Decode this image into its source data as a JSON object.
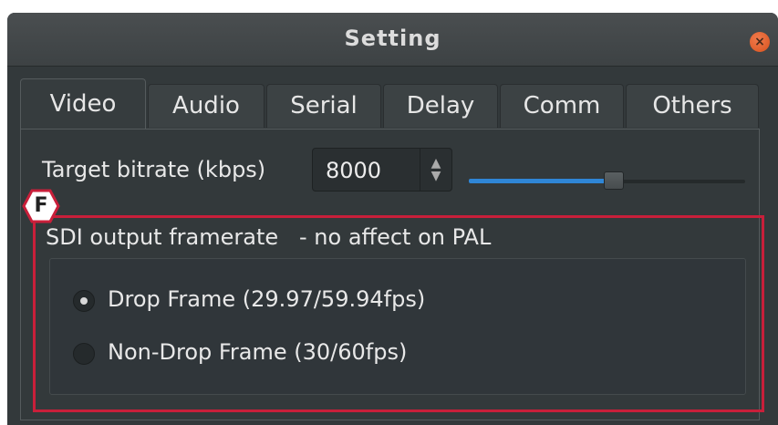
{
  "window": {
    "title": "Setting",
    "close_icon": "close-icon",
    "close_glyph": "×"
  },
  "tabs": [
    {
      "label": "Video",
      "active": true
    },
    {
      "label": "Audio",
      "active": false
    },
    {
      "label": "Serial",
      "active": false
    },
    {
      "label": "Delay",
      "active": false
    },
    {
      "label": "Comm",
      "active": false
    },
    {
      "label": "Others",
      "active": false
    }
  ],
  "video": {
    "bitrate_label": "Target bitrate (kbps)",
    "bitrate_value": "8000",
    "slider_level": 0.5,
    "framerate_group_label": "SDI output framerate   - no affect on PAL",
    "options": [
      {
        "label": "Drop Frame (29.97/59.94fps)",
        "checked": true
      },
      {
        "label": "Non-Drop Frame (30/60fps)",
        "checked": false
      }
    ]
  },
  "annotation": {
    "letter": "F",
    "color": "#c91f3a"
  },
  "colors": {
    "accent": "#2f86d6",
    "close": "#e2612a"
  }
}
